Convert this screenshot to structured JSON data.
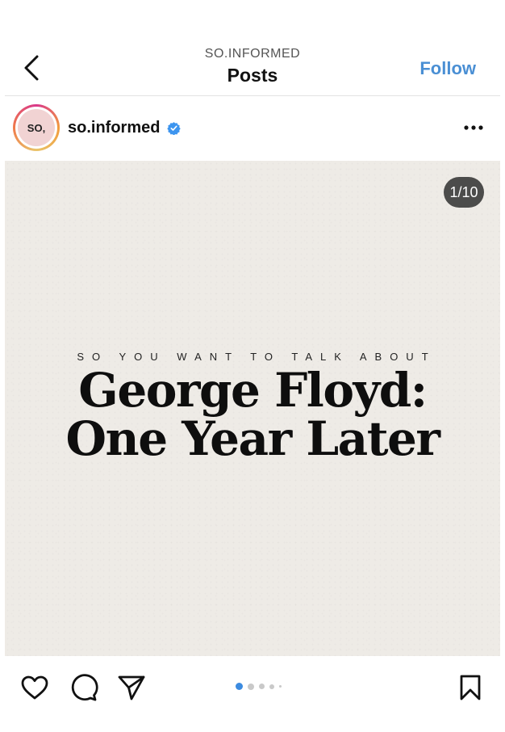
{
  "header": {
    "account_caps": "SO.INFORMED",
    "title": "Posts",
    "follow_label": "Follow"
  },
  "account": {
    "avatar_text": "SO,",
    "username": "so.informed",
    "verified": true
  },
  "post": {
    "slide_counter": "1/10",
    "kicker": "SO YOU WANT TO TALK ABOUT",
    "headline_line1": "George Floyd:",
    "headline_line2": "One Year Later",
    "current_slide": 1,
    "total_slides": 10
  },
  "icons": {
    "back": "chevron-left-icon",
    "verified": "verified-badge-icon",
    "more": "more-horizontal-icon",
    "like": "heart-icon",
    "comment": "comment-bubble-icon",
    "share": "paper-plane-icon",
    "save": "bookmark-icon"
  },
  "colors": {
    "follow_blue": "#4a8fd4",
    "verified_blue": "#3d95ef",
    "active_dot": "#3c8be0",
    "post_bg": "#eeebe6"
  }
}
